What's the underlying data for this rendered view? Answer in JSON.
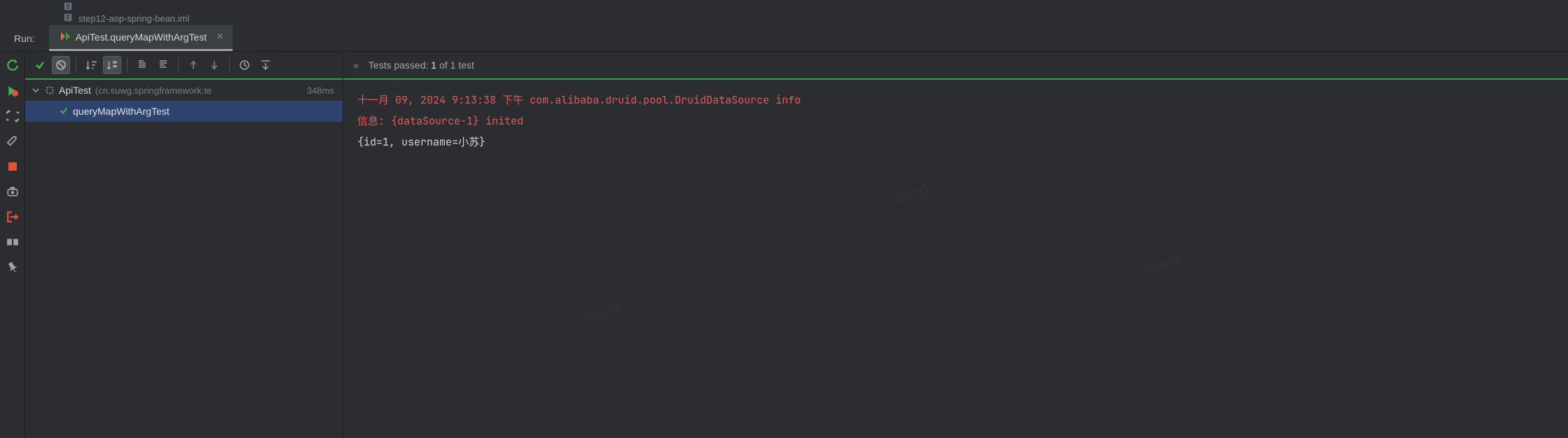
{
  "top_files": [
    {
      "name": ""
    },
    {
      "name": "step12-aop-spring-bean.iml"
    }
  ],
  "run_label": "Run:",
  "run_tab": {
    "title": "ApiTest.queryMapWithArgTest",
    "close_glyph": "×"
  },
  "tree": {
    "root": {
      "name": "ApiTest",
      "pkg": "(cn.suwg.springframework.te",
      "time": "348ms"
    },
    "child": {
      "name": "queryMapWithArgTest"
    }
  },
  "tests_header": {
    "chevrons": "»",
    "label": "Tests passed:",
    "passed": "1",
    "suffix": "of 1 test"
  },
  "console": {
    "line1": "十一月 09, 2024 9:13:38 下午 com.alibaba.druid.pool.DruidDataSource info",
    "line2": "信息: {dataSource-1} inited",
    "line3": "{id=1, username=小苏}"
  },
  "watermark": "suwg"
}
